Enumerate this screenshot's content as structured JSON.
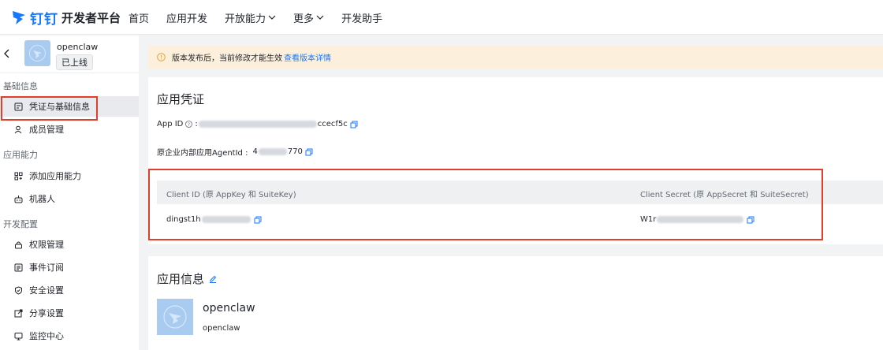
{
  "header": {
    "brand": "钉钉",
    "platform": "开发者平台",
    "nav": [
      {
        "label": "首页",
        "dropdown": false
      },
      {
        "label": "应用开发",
        "dropdown": false
      },
      {
        "label": "开放能力",
        "dropdown": true
      },
      {
        "label": "更多",
        "dropdown": true
      },
      {
        "label": "开发助手",
        "dropdown": false
      }
    ]
  },
  "sidebar": {
    "app_name": "openclaw",
    "app_status": "已上线",
    "groups": [
      {
        "title": "基础信息",
        "items": [
          {
            "label": "凭证与基础信息",
            "icon": "credential-icon",
            "active": true
          },
          {
            "label": "成员管理",
            "icon": "member-icon",
            "active": false
          }
        ]
      },
      {
        "title": "应用能力",
        "items": [
          {
            "label": "添加应用能力",
            "icon": "grid-add-icon",
            "active": false
          },
          {
            "label": "机器人",
            "icon": "robot-icon",
            "active": false
          }
        ]
      },
      {
        "title": "开发配置",
        "items": [
          {
            "label": "权限管理",
            "icon": "lock-icon",
            "active": false
          },
          {
            "label": "事件订阅",
            "icon": "event-icon",
            "active": false
          },
          {
            "label": "安全设置",
            "icon": "shield-icon",
            "active": false
          },
          {
            "label": "分享设置",
            "icon": "share-icon",
            "active": false
          },
          {
            "label": "监控中心",
            "icon": "monitor-icon",
            "active": false
          }
        ]
      }
    ]
  },
  "notice": {
    "text": "版本发布后，当前修改才能生效",
    "link": "查看版本详情"
  },
  "credentials": {
    "title": "应用凭证",
    "app_id_label": "App ID",
    "app_id_suffix": "ccecf5c",
    "agent_label": "原企业内部应用AgentId :",
    "agent_prefix": "4",
    "agent_suffix": "770",
    "client_id_header": "Client ID (原 AppKey 和 SuiteKey)",
    "client_secret_header": "Client Secret (原 AppSecret 和 SuiteSecret)",
    "client_id_value": "dingst1h",
    "client_secret_value": "W1r"
  },
  "app_info": {
    "title": "应用信息",
    "name": "openclaw",
    "subtitle": "openclaw"
  },
  "colors": {
    "accent": "#1677ff",
    "highlight": "#e0402a",
    "notice_bg": "#fcf0dc"
  }
}
